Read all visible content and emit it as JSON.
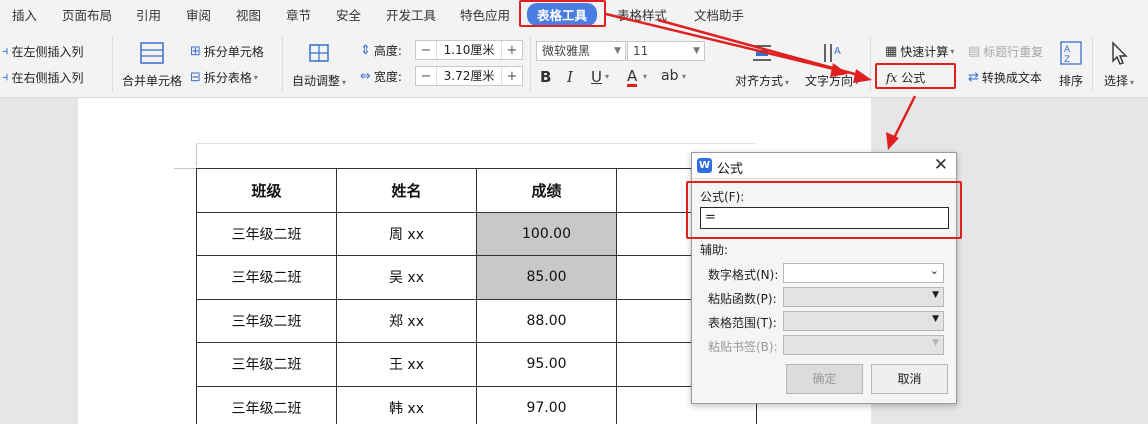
{
  "menu": {
    "tabs": [
      "插入",
      "页面布局",
      "引用",
      "审阅",
      "视图",
      "章节",
      "安全",
      "开发工具",
      "特色应用",
      "表格工具",
      "表格样式",
      "文档助手"
    ],
    "active": "表格工具"
  },
  "ribbon": {
    "insert_left_col": "在左侧插入列",
    "insert_right_col": "在右侧插入列",
    "merge_cells": "合并单元格",
    "split_cells": "拆分单元格",
    "split_table": "拆分表格",
    "auto_adjust": "自动调整",
    "height_label": "高度:",
    "height_value": "1.10厘米",
    "width_label": "宽度:",
    "width_value": "3.72厘米",
    "font_name": "微软雅黑",
    "font_size": "11",
    "bold": "B",
    "italic": "I",
    "underline": "U",
    "font_color": "A",
    "highlight": "ab",
    "align": "对齐方式",
    "text_dir": "文字方向",
    "quick_calc": "快速计算",
    "header_repeat": "标题行重复",
    "formula": "公式",
    "convert_text": "转换成文本",
    "sort": "排序",
    "select": "选择",
    "fx": "fx"
  },
  "table": {
    "headers": [
      "班级",
      "姓名",
      "成绩"
    ],
    "rows": [
      [
        "三年级二班",
        "周 xx",
        "100.00"
      ],
      [
        "三年级二班",
        "吴 xx",
        "85.00"
      ],
      [
        "三年级二班",
        "郑 xx",
        "88.00"
      ],
      [
        "三年级二班",
        "王 xx",
        "95.00"
      ],
      [
        "三年级二班",
        "韩 xx",
        "97.00"
      ]
    ]
  },
  "dialog": {
    "title": "公式",
    "formula_label": "公式(F):",
    "formula_value": "=",
    "aux_label": "辅助:",
    "number_format": "数字格式(N):",
    "paste_function": "粘贴函数(P):",
    "table_range": "表格范围(T):",
    "paste_bookmark": "粘贴书签(B):",
    "ok": "确定",
    "cancel": "取消"
  },
  "colors": {
    "accent": "#4a7de2",
    "annotation_red": "#e02020",
    "highlight_cell": "#c8c8c8"
  }
}
